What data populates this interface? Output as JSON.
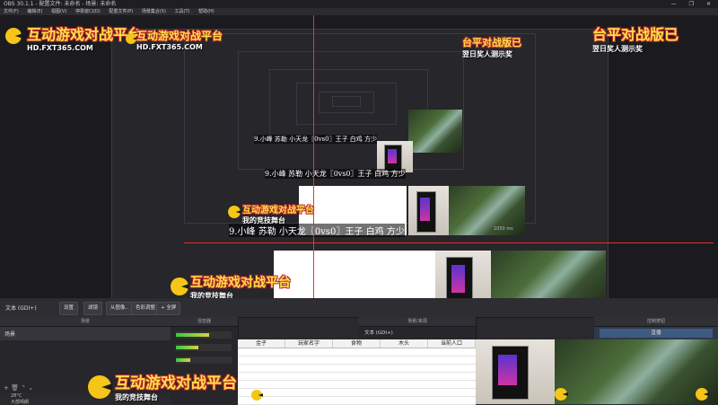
{
  "window": {
    "title": "OBS 30.1.1 - 配置文件: 未命名 - 场景: 未命名",
    "controls": "— ❐ ✕"
  },
  "menu": [
    "文件(F)",
    "编辑(E)",
    "视图(V)",
    "停靠窗口(D)",
    "配置文件(P)",
    "场景集合(S)",
    "工具(T)",
    "帮助(H)"
  ],
  "overlay": {
    "logo_main": "互动游戏对战平台",
    "logo_url": "HD.FXT365.COM",
    "logo_right_main": "台平对战版已",
    "logo_right_sub": "翌日奖人测示奖",
    "caption": "9.小峰 苏勒 小天龙〖0vs0〗王子 白鸡 方少",
    "logo_bottom_sub": "我的竞技舞台",
    "time_readout": "1050 ms"
  },
  "spreadsheet": {
    "headers": [
      "金子",
      "玩家名字",
      "食物",
      "木头",
      "当前人口"
    ],
    "rows": 8
  },
  "controls": {
    "source_label": "文本 (GDI+)",
    "buttons": [
      "设置",
      "滤镜",
      "从图像..",
      "色彩调整",
      "+ 全屏"
    ],
    "scene_item": "场景",
    "panel_scenes": "场景",
    "panel_sources": "来源",
    "panel_mixer": "混音器",
    "panel_transitions": "转场特效",
    "panel_controls": "控制按钮",
    "panel_extra": "场景/来源",
    "transition_name": "直播",
    "status_temp": "28°C",
    "status_text": "大部晴朗"
  },
  "colors": {
    "accent": "#e33333",
    "logo_yellow": "#ffe04a",
    "logo_red": "#b42828"
  }
}
